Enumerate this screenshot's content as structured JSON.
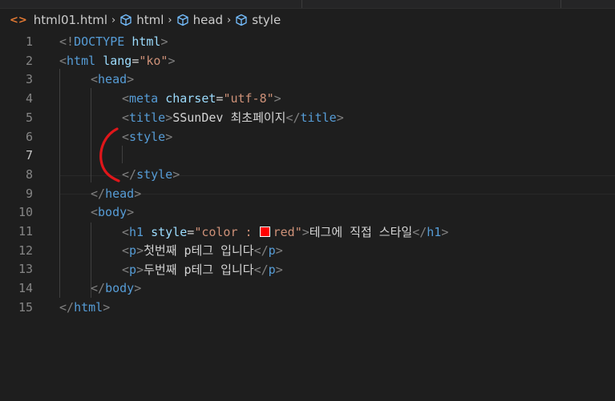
{
  "breadcrumb": {
    "file": "html01.html",
    "items": [
      "html",
      "head",
      "style"
    ]
  },
  "colors": {
    "background": "#1e1e1e",
    "tag": "#569cd6",
    "attribute": "#9cdcfe",
    "string": "#ce9178",
    "punctuation": "#808080",
    "text": "#d4d4d4",
    "line_number": "#858585",
    "annotation": "#e0161a"
  },
  "editor": {
    "active_line": 7,
    "lines": [
      {
        "n": "1",
        "tokens": [
          [
            "p",
            "<!"
          ],
          [
            "t",
            "DOCTYPE"
          ],
          [
            "x",
            " "
          ],
          [
            "a",
            "html"
          ],
          [
            "p",
            ">"
          ]
        ]
      },
      {
        "n": "2",
        "tokens": [
          [
            "p",
            "<"
          ],
          [
            "t",
            "html"
          ],
          [
            "x",
            " "
          ],
          [
            "a",
            "lang"
          ],
          [
            "x",
            "="
          ],
          [
            "s",
            "\"ko\""
          ],
          [
            "p",
            ">"
          ]
        ]
      },
      {
        "n": "3",
        "tokens": [
          [
            "p",
            "<"
          ],
          [
            "t",
            "head"
          ],
          [
            "p",
            ">"
          ]
        ]
      },
      {
        "n": "4",
        "tokens": [
          [
            "p",
            "<"
          ],
          [
            "t",
            "meta"
          ],
          [
            "x",
            " "
          ],
          [
            "a",
            "charset"
          ],
          [
            "x",
            "="
          ],
          [
            "s",
            "\"utf-8\""
          ],
          [
            "p",
            ">"
          ]
        ]
      },
      {
        "n": "5",
        "tokens": [
          [
            "p",
            "<"
          ],
          [
            "t",
            "title"
          ],
          [
            "p",
            ">"
          ],
          [
            "x",
            "SSunDev 최초페이지"
          ],
          [
            "p",
            "</"
          ],
          [
            "t",
            "title"
          ],
          [
            "p",
            ">"
          ]
        ]
      },
      {
        "n": "6",
        "tokens": [
          [
            "p",
            "<"
          ],
          [
            "t",
            "style"
          ],
          [
            "p",
            ">"
          ]
        ]
      },
      {
        "n": "7",
        "tokens": []
      },
      {
        "n": "8",
        "tokens": [
          [
            "p",
            "</"
          ],
          [
            "t",
            "style"
          ],
          [
            "p",
            ">"
          ]
        ]
      },
      {
        "n": "9",
        "tokens": [
          [
            "p",
            "</"
          ],
          [
            "t",
            "head"
          ],
          [
            "p",
            ">"
          ]
        ]
      },
      {
        "n": "10",
        "tokens": [
          [
            "p",
            "<"
          ],
          [
            "t",
            "body"
          ],
          [
            "p",
            ">"
          ]
        ]
      },
      {
        "n": "11",
        "tokens": [
          [
            "p",
            "<"
          ],
          [
            "t",
            "h1"
          ],
          [
            "x",
            " "
          ],
          [
            "a",
            "style"
          ],
          [
            "x",
            "="
          ],
          [
            "s",
            "\"color : "
          ],
          [
            "w",
            ""
          ],
          [
            "s",
            "red"
          ],
          [
            "s",
            "\""
          ],
          [
            "p",
            ">"
          ],
          [
            "x",
            "테그에 직접 스타일"
          ],
          [
            "p",
            "</"
          ],
          [
            "t",
            "h1"
          ],
          [
            "p",
            ">"
          ]
        ]
      },
      {
        "n": "12",
        "tokens": [
          [
            "p",
            "<"
          ],
          [
            "t",
            "p"
          ],
          [
            "p",
            ">"
          ],
          [
            "x",
            "첫번째 p테그 입니다"
          ],
          [
            "p",
            "</"
          ],
          [
            "t",
            "p"
          ],
          [
            "p",
            ">"
          ]
        ]
      },
      {
        "n": "13",
        "tokens": [
          [
            "p",
            "<"
          ],
          [
            "t",
            "p"
          ],
          [
            "p",
            ">"
          ],
          [
            "x",
            "두번째 p테그 입니다"
          ],
          [
            "p",
            "</"
          ],
          [
            "t",
            "p"
          ],
          [
            "p",
            ">"
          ]
        ]
      },
      {
        "n": "14",
        "tokens": [
          [
            "p",
            "</"
          ],
          [
            "t",
            "body"
          ],
          [
            "p",
            ">"
          ]
        ]
      },
      {
        "n": "15",
        "tokens": [
          [
            "p",
            "</"
          ],
          [
            "t",
            "html"
          ],
          [
            "p",
            ">"
          ]
        ]
      }
    ]
  }
}
